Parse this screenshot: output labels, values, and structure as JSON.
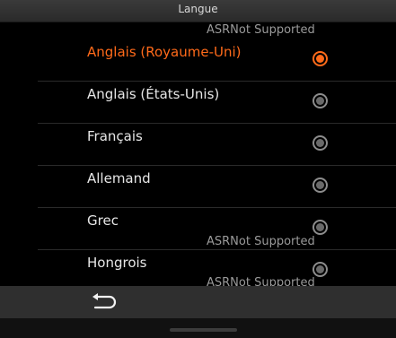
{
  "header": {
    "title": "Langue",
    "asr_status": "ASRNot Supported"
  },
  "languages": [
    {
      "label": "Anglais (Royaume-Uni)",
      "selected": true
    },
    {
      "label": "Anglais (États-Unis)",
      "selected": false
    },
    {
      "label": "Français",
      "selected": false
    },
    {
      "label": "Allemand",
      "selected": false
    },
    {
      "label": "Grec",
      "selected": false
    },
    {
      "label": "Hongrois",
      "selected": false
    }
  ],
  "overlays": {
    "asr_status_grec": "ASRNot Supported",
    "asr_status_hongrois": "ASRNot Supported"
  },
  "footer": {
    "back_icon": "back-arrow-icon"
  },
  "colors": {
    "accent": "#ff6a1a",
    "text": "#e6e6e6",
    "background": "#000000"
  }
}
